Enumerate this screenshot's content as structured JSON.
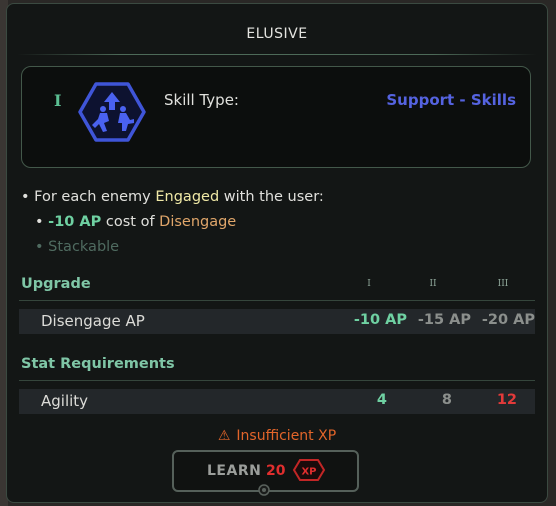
{
  "tooltip": {
    "title": "ELUSIVE",
    "skill": {
      "tier": "I",
      "icon": "unit-evade-hexagon-icon",
      "type_label": "Skill Type:",
      "type_value": "Support - Skills"
    },
    "description": {
      "bullet_glyph": "•",
      "line1_prefix": "For each enemy",
      "line1_keyword": "Engaged",
      "line1_suffix": "with the user:",
      "line2_value": "-10 AP",
      "line2_text": "cost of",
      "line2_keyword": "Disengage",
      "line3": "Stackable"
    },
    "upgrade": {
      "heading": "Upgrade",
      "tiers": [
        "I",
        "II",
        "III"
      ],
      "rows": [
        {
          "label": "Disengage AP",
          "values": [
            "-10 AP",
            "-15 AP",
            "-20 AP"
          ]
        }
      ]
    },
    "requirements": {
      "heading": "Stat Requirements",
      "rows": [
        {
          "label": "Agility",
          "values": [
            "4",
            "8",
            "12"
          ]
        }
      ]
    },
    "warning": {
      "icon": "warning-triangle-icon",
      "text": "Insufficient XP"
    },
    "learn": {
      "label": "LEARN",
      "cost": "20",
      "currency": "XP"
    }
  },
  "colors": {
    "accent_green": "#6fd1a2",
    "skill_type_blue": "#5563e0",
    "keyword_yellow": "#f0e9a6",
    "keyword_orange": "#e0a66a",
    "error_red": "#e23a3a",
    "warning_orange": "#e2652a"
  }
}
